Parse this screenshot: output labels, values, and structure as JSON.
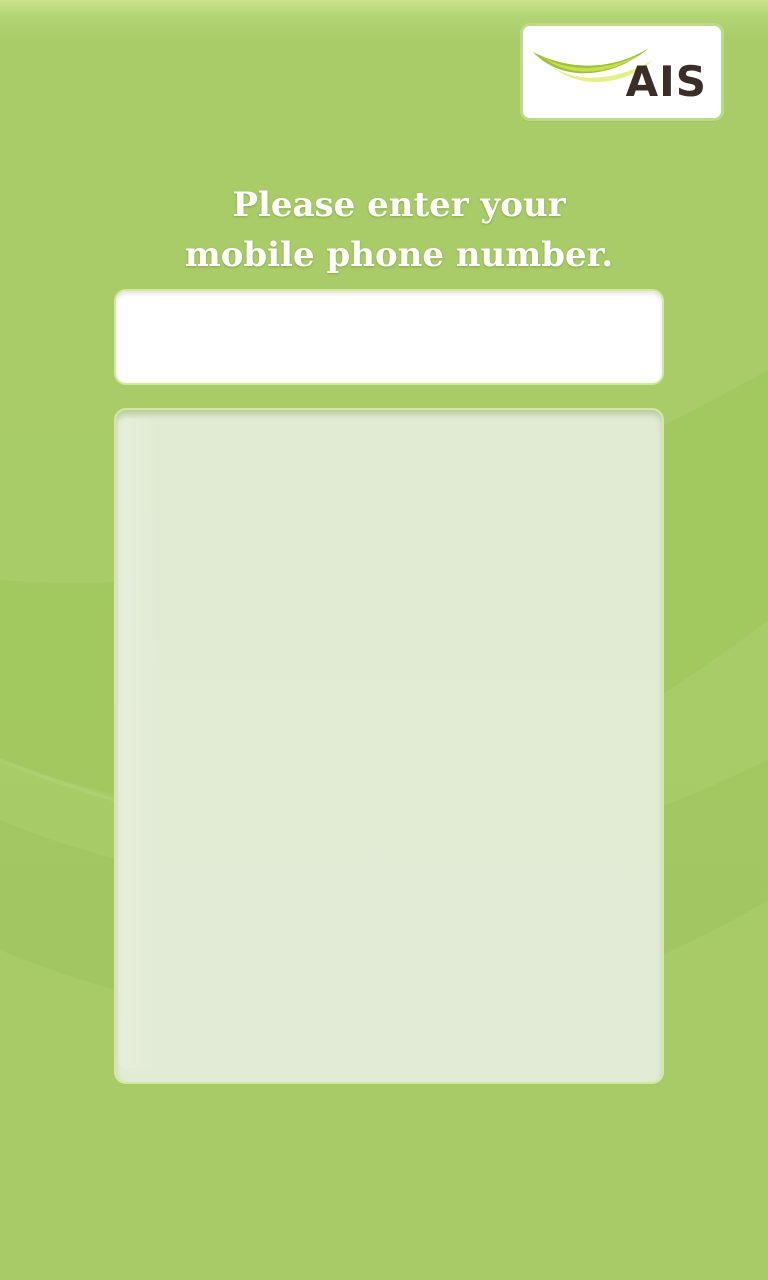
{
  "brand": {
    "logo_text": "AIS",
    "logo_icon": "ais-swoosh-icon",
    "colors": {
      "background": "#a8cb68",
      "text_dark": "#3b2e2a",
      "swoosh_green": "#9cc13a"
    }
  },
  "prompt": {
    "line1": "Please enter your",
    "line2": "mobile phone number."
  },
  "phone_input": {
    "value": "",
    "placeholder": ""
  },
  "keypad_panel": {
    "content": ""
  }
}
